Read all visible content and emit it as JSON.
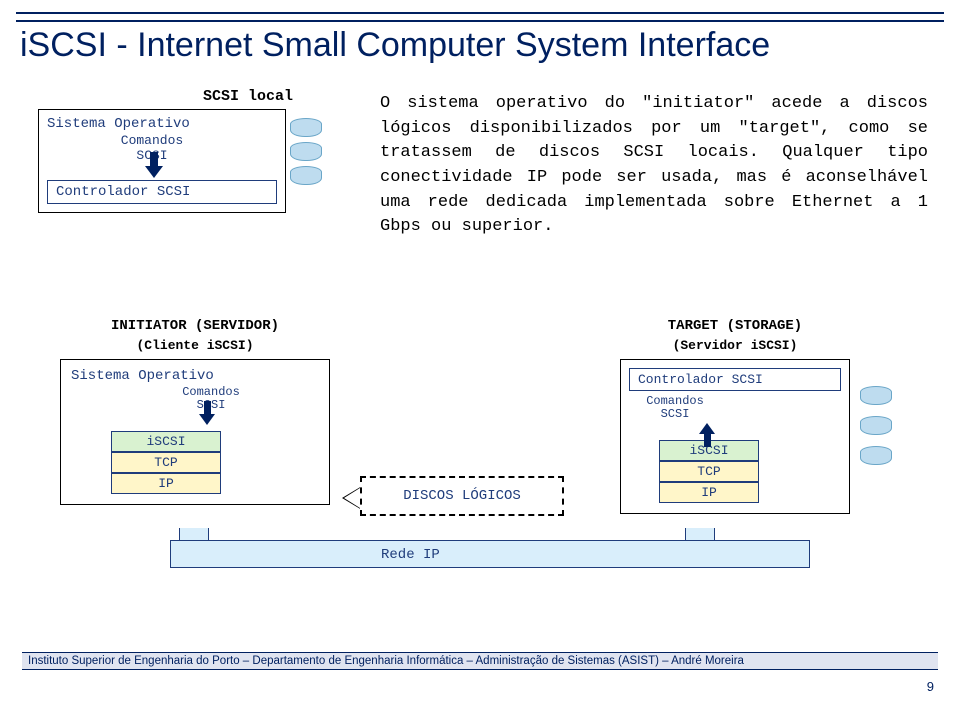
{
  "title": "iSCSI - Internet Small Computer System Interface",
  "body_text": "O sistema operativo do \"initiator\" acede a discos lógicos disponibilizados por um \"target\", como se tratassem de discos SCSI locais. Qualquer tipo conectividade IP pode ser usada, mas é aconselhável uma rede dedicada implementada sobre Ethernet a 1 Gbps ou superior.",
  "scsi_local": {
    "heading": "SCSI local",
    "sys_op": "Sistema Operativo",
    "cmds_line1": "Comandos",
    "cmds_line2": "SCSI",
    "controller": "Controlador SCSI"
  },
  "initiator": {
    "title": "INITIATOR (SERVIDOR)",
    "subtitle": "(Cliente iSCSI)",
    "sys_op": "Sistema Operativo",
    "cmds_line1": "Comandos",
    "cmds_line2": "SCSI",
    "stack": {
      "iscsi": "iSCSI",
      "tcp": "TCP",
      "ip": "IP"
    }
  },
  "target": {
    "title": "TARGET (STORAGE)",
    "subtitle": "(Servidor iSCSI)",
    "controller": "Controlador SCSI",
    "cmds_line1": "Comandos",
    "cmds_line2": "SCSI",
    "stack": {
      "iscsi": "iSCSI",
      "tcp": "TCP",
      "ip": "IP"
    }
  },
  "discos_logicos": "DISCOS LÓGICOS",
  "rede_ip": "Rede IP",
  "footer": "Instituto Superior de Engenharia do Porto – Departamento de Engenharia Informática – Administração de Sistemas (ASIST) – André Moreira",
  "page_number": "9"
}
